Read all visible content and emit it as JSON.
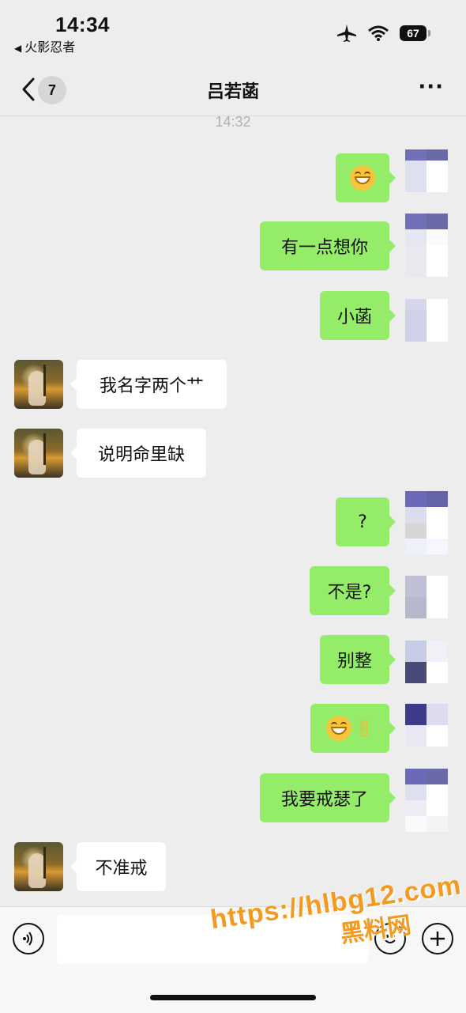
{
  "status_bar": {
    "time": "14:34",
    "back_app": "火影忍者",
    "battery": "67"
  },
  "nav": {
    "unread_count": "7",
    "title": "吕若菡",
    "more": "···"
  },
  "timestamp": "14:32",
  "messages": [
    {
      "from": "me",
      "text": "",
      "emoji": "grinning-face"
    },
    {
      "from": "me",
      "text": "有一点想你"
    },
    {
      "from": "me",
      "text": "小菡"
    },
    {
      "from": "them",
      "text": "我名字两个艹"
    },
    {
      "from": "them",
      "text": "说明命里缺"
    },
    {
      "from": "me",
      "text": "?"
    },
    {
      "from": "me",
      "text": "不是?"
    },
    {
      "from": "me",
      "text": "别整"
    },
    {
      "from": "me",
      "text": "",
      "emoji": "laughing-crying-face ok-hand"
    },
    {
      "from": "me",
      "text": "我要戒瑟了"
    },
    {
      "from": "them",
      "text": "不准戒"
    }
  ],
  "input": {
    "placeholder": ""
  },
  "watermark": {
    "url": "https://hlbg12.com",
    "name": "黑料网"
  },
  "colors": {
    "my_bubble": "#95ec69",
    "their_bubble": "#ffffff",
    "background": "#ededed"
  }
}
